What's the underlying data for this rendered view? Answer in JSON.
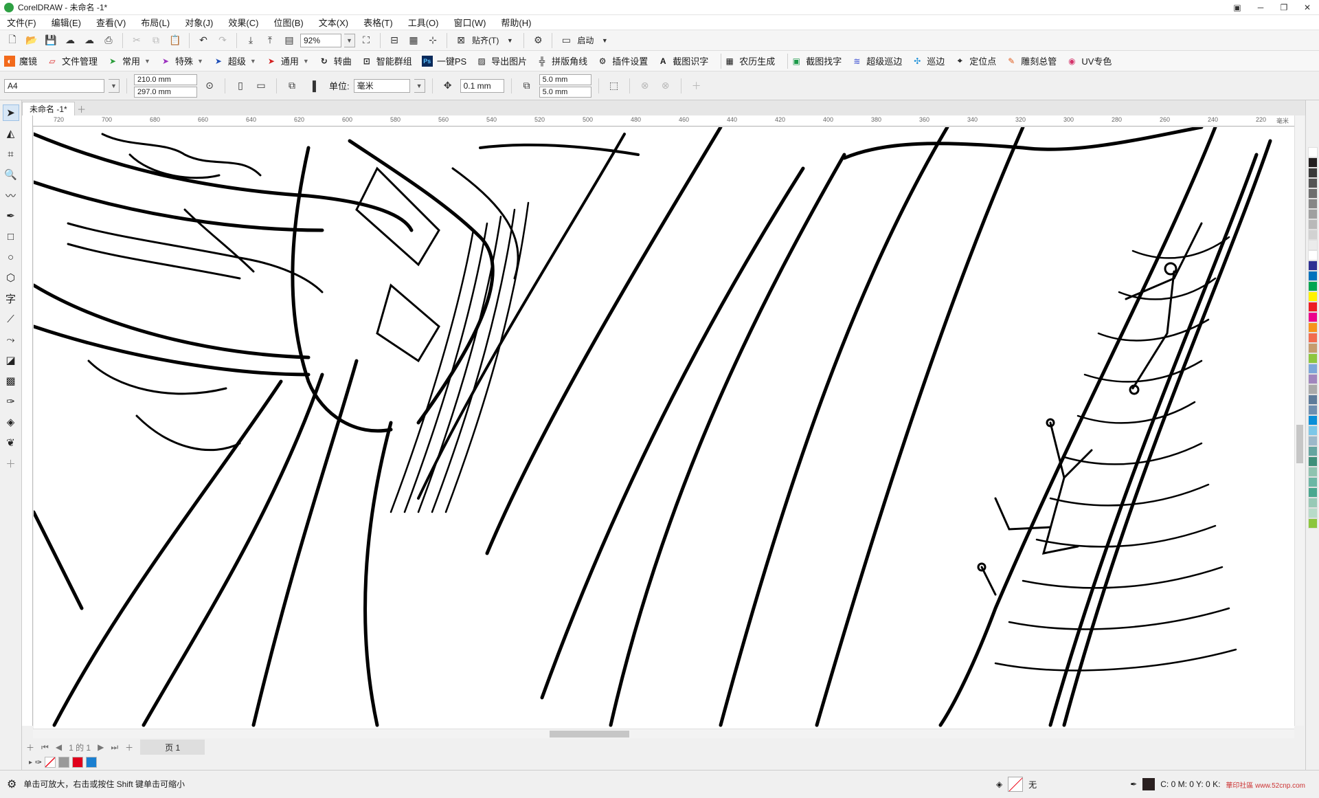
{
  "window": {
    "title": "CorelDRAW - 未命名 -1*"
  },
  "menu": [
    "文件(F)",
    "编辑(E)",
    "查看(V)",
    "布局(L)",
    "对象(J)",
    "效果(C)",
    "位图(B)",
    "文本(X)",
    "表格(T)",
    "工具(O)",
    "窗口(W)",
    "帮助(H)"
  ],
  "standard_toolbar": {
    "zoom_value": "92%",
    "snap_label": "贴齐(T)",
    "launch_label": "启动"
  },
  "plugin_bar": [
    "魔镜",
    "文件管理",
    "常用",
    "特殊",
    "超级",
    "通用",
    "转曲",
    "智能群组",
    "一键PS",
    "导出图片",
    "拼版角线",
    "插件设置",
    "截图识字",
    "农历生成",
    "截图找字",
    "超级巡边",
    "巡边",
    "定位点",
    "雕刻总管",
    "UV专色"
  ],
  "property_bar": {
    "page_size": "A4",
    "width": "210.0 mm",
    "height": "297.0 mm",
    "unit_label": "单位:",
    "unit_value": "毫米",
    "nudge": "0.1 mm",
    "dup_x": "5.0 mm",
    "dup_y": "5.0 mm"
  },
  "doc_tab": "未命名 -1*",
  "ruler_ticks": [
    "720",
    "700",
    "680",
    "660",
    "640",
    "620",
    "600",
    "580",
    "560",
    "540",
    "520",
    "500",
    "480",
    "460",
    "440",
    "420",
    "400",
    "380",
    "360",
    "340",
    "320",
    "300",
    "280",
    "260",
    "240",
    "220",
    "毫米"
  ],
  "page_nav": {
    "count": "1 的 1",
    "page_tab": "页 1"
  },
  "status": {
    "hint": "单击可放大，右击或按住 Shift 键单击可缩小",
    "fill_label": "无",
    "color_readout": "C: 0 M: 0 Y: 0 K:",
    "watermark": "華印社區 www.52cnp.com"
  },
  "colors": {
    "palette": [
      "#ffffff",
      "#231f20",
      "#3a3a3a",
      "#555555",
      "#6e6e6e",
      "#878787",
      "#a0a0a0",
      "#b9b9b9",
      "#d2d2d2",
      "#ebebeb",
      "#ffffff",
      "#2e3192",
      "#0072bc",
      "#00a651",
      "#fff200",
      "#ed1c24",
      "#ec008c",
      "#f7941d",
      "#f26c4f",
      "#c69c6d",
      "#8dc63f",
      "#7da7d9",
      "#a186be",
      "#aaaaaa",
      "#5d7b9a",
      "#6e8fb0",
      "#0a8fd8",
      "#7cc7e8",
      "#9cb8c9",
      "#65a5a0",
      "#3f8f7a",
      "#8fc3b0",
      "#6cb7a5",
      "#4aa78f",
      "#98c9b6",
      "#b8dbc9",
      "#8cc63e"
    ],
    "doc_palette": [
      "#999999",
      "#e0001b",
      "#1a7fd0"
    ],
    "accent": "#d7e6f5"
  }
}
